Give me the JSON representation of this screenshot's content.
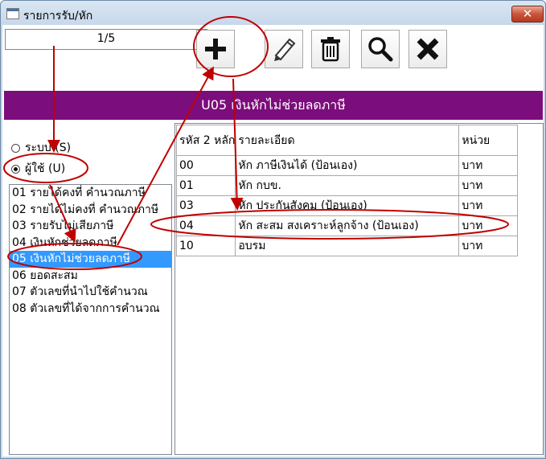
{
  "window": {
    "title": "รายการรับ/หัก",
    "close_glyph": "✕"
  },
  "toolbar": {
    "counter": "1/5",
    "buttons": [
      "add-icon",
      "edit-icon",
      "delete-icon",
      "search-icon",
      "cancel-icon"
    ]
  },
  "banner": {
    "text": "U05 เงินหักไม่ช่วยลดภาษี"
  },
  "mode": {
    "system_label": "ระบบ (S)",
    "user_label": "ผู้ใช้ (U)",
    "selected": "user"
  },
  "categories": [
    {
      "label": "01 รายได้คงที่ คำนวณภาษี",
      "selected": false
    },
    {
      "label": "02 รายได้ไม่คงที่ คำนวณภาษี",
      "selected": false
    },
    {
      "label": "03 รายรับไม่เสียภาษี",
      "selected": false
    },
    {
      "label": "04 เงินหักช่วยลดภาษี",
      "selected": false
    },
    {
      "label": "05 เงินหักไม่ช่วยลดภาษี",
      "selected": true
    },
    {
      "label": "06 ยอดสะสม",
      "selected": false
    },
    {
      "label": "07 ตัวเลขที่นำไปใช้คำนวณ",
      "selected": false
    },
    {
      "label": "08 ตัวเลขที่ได้จากการคำนวณ",
      "selected": false
    }
  ],
  "table": {
    "headers": [
      "รหัส 2 หลัก",
      "รายละเอียด",
      "หน่วย"
    ],
    "rows": [
      [
        "00",
        "หัก ภาษีเงินได้ (ป้อนเอง)",
        "บาท"
      ],
      [
        "01",
        "หัก กบข.",
        "บาท"
      ],
      [
        "03",
        "หัก ประกันสังคม (ป้อนเอง)",
        "บาท"
      ],
      [
        "04",
        "หัก สะสม สงเคราะห์ลูกจ้าง (ป้อนเอง)",
        "บาท"
      ],
      [
        "10",
        "อบรม",
        "บาท"
      ]
    ]
  },
  "colors": {
    "banner": "#7c0d7c",
    "selection": "#3399ff",
    "annotation": "#c00000"
  }
}
